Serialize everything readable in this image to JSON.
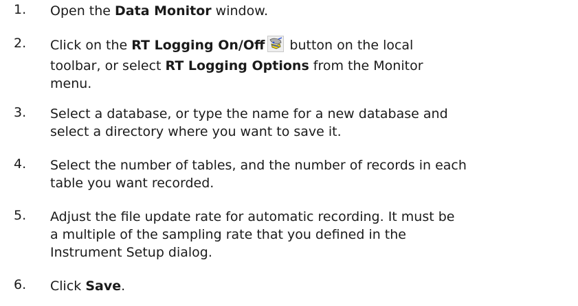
{
  "steps": [
    {
      "number": "1.",
      "lines": [
        {
          "a": "Open the ",
          "b": "Data Monitor",
          "c": " window."
        }
      ]
    },
    {
      "number": "2.",
      "lines": [
        {
          "a": "Click on the ",
          "b": "RT Logging On/Off",
          "c": " button on the local"
        },
        {
          "a": "toolbar, or select ",
          "b": "RT Logging Options",
          "c": " from the Monitor"
        },
        {
          "a": "menu."
        }
      ],
      "icon": "rt-logging-toolbar-icon"
    },
    {
      "number": "3.",
      "lines": [
        {
          "a": "Select a database, or type the name for a new database and"
        },
        {
          "a": "select a directory where you want to save it."
        }
      ]
    },
    {
      "number": "4.",
      "lines": [
        {
          "a": "Select the number of tables, and the number of records in each"
        },
        {
          "a": "table you want recorded."
        }
      ]
    },
    {
      "number": "5.",
      "lines": [
        {
          "a": "Adjust the file update rate for automatic recording. It must be"
        },
        {
          "a": "a multiple of the sampling rate that you defined in the"
        },
        {
          "a": "Instrument Setup dialog."
        }
      ]
    },
    {
      "number": "6.",
      "lines": [
        {
          "a": "Click ",
          "b": "Save",
          "c": "."
        }
      ]
    }
  ]
}
